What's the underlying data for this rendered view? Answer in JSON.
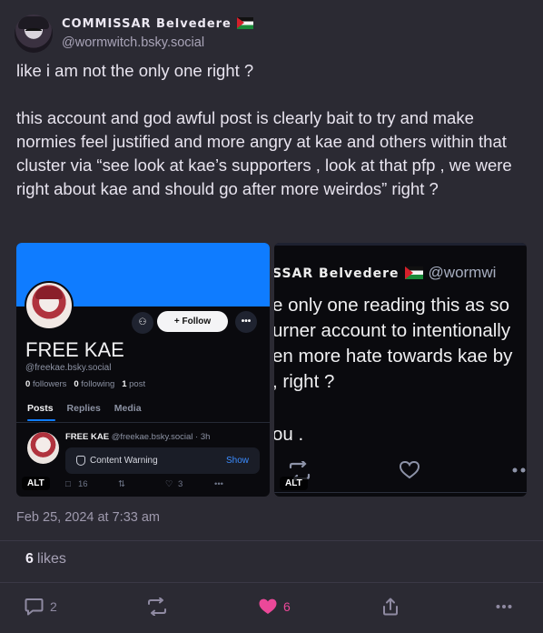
{
  "author": {
    "display_name": "COMMISSAR Belvedere",
    "handle": "@wormwitch.bsky.social"
  },
  "post": {
    "paragraphs": [
      "like i am not the only one right ?",
      "this account and god awful post is clearly bait to try and make normies feel justified and more angry at kae and others within that cluster via “see look at kae’s supporters , look at that pfp , we were right about kae and should go after more weirdos” right ?"
    ],
    "timestamp": "Feb 25, 2024 at 7:33 am",
    "likes_count": "6",
    "likes_label": "likes"
  },
  "image1": {
    "follow_label": "+ Follow",
    "profile_name": "FREE KAE",
    "profile_handle": "@freekae.bsky.social",
    "followers_count": "0",
    "followers_label": "followers",
    "following_count": "0",
    "following_label": "following",
    "posts_count": "1",
    "posts_label": "post",
    "tabs": [
      "Posts",
      "Replies",
      "Media"
    ],
    "mini_post": {
      "name": "FREE KAE",
      "meta": "@freekae.bsky.social · 3h",
      "cw_label": "Content Warning",
      "show_label": "Show",
      "replies": "16",
      "likes": "3"
    },
    "alt_badge": "ALT"
  },
  "image2": {
    "name_fragment": "SSAR Belvedere",
    "handle_fragment": "@wormwi",
    "lines": [
      "e only one reading this as so",
      "urner account to intentionally",
      "en more hate towards kae by",
      ", right ?",
      "ou ."
    ],
    "alt_badge": "ALT"
  },
  "actions": {
    "reply_count": "2",
    "like_count": "6"
  },
  "colors": {
    "background": "#2b2a33",
    "like_pink": "#ec4899",
    "link_blue": "#0f7cff"
  }
}
